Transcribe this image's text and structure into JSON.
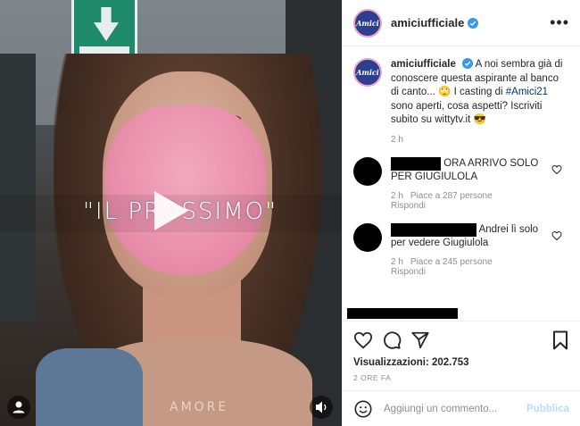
{
  "video": {
    "caption": "\"IL PROSSIMO\"",
    "necklace_text": "AMORE"
  },
  "post": {
    "username": "amiciufficiale",
    "avatar_text": "Amici",
    "verified": true,
    "caption": {
      "username": "amiciufficiale",
      "text_part1": " A noi sembra già di conoscere questa aspirante al banco di canto... ",
      "emoji1": "🙄",
      "text_part2": " I casting di ",
      "hashtag": "#Amici21",
      "text_part3": " sono aperti, cosa aspetti? Iscriviti subito su wittytv.it ",
      "emoji2": "😎",
      "time": "2 h"
    },
    "comments": [
      {
        "text": "ORA ARRIVO SOLO PER GIUGIULOLA",
        "time": "2 h",
        "likes": "Piace a 287 persone",
        "reply": "Rispondi"
      },
      {
        "text": "Andrei lì solo per vedere Giugiulola",
        "time": "2 h",
        "likes": "Piace a 245 persone",
        "reply": "Rispondi"
      }
    ],
    "views": "Visualizzazioni: 202.753",
    "posted_ago": "2 ORE FA",
    "comment_placeholder": "Aggiungi un commento...",
    "publish_label": "Pubblica"
  },
  "colors": {
    "link": "#00376b",
    "verified": "#3897f0",
    "publish_disabled": "#b2dffc",
    "mask_pink": "#e98fac"
  }
}
